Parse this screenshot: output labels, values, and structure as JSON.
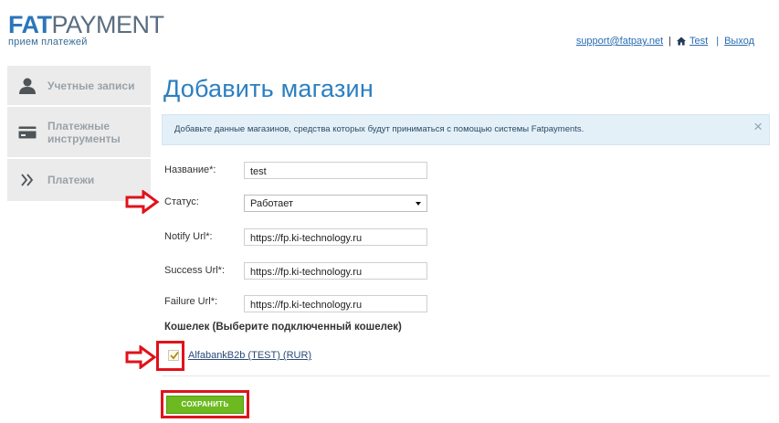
{
  "header": {
    "logo_fat": "FAT",
    "logo_payment": "PAYMENT",
    "logo_tagline": "прием платежей",
    "support_email": "support@fatpay.net",
    "separator": "|",
    "user_name": "Test",
    "logout_label": "Выход"
  },
  "sidebar": {
    "items": [
      {
        "label": "Учетные записи",
        "icon": "user-icon"
      },
      {
        "label": "Платежные инструменты",
        "icon": "card-icon"
      },
      {
        "label": "Платежи",
        "icon": "double-chevron-right-icon"
      }
    ]
  },
  "main": {
    "title": "Добавить магазин",
    "info_text": "Добавьте данные магазинов, средства которых будут приниматься с помощью системы Fatpayments.",
    "info_close": "×",
    "form": {
      "name": {
        "label": "Название*:",
        "value": "test"
      },
      "status": {
        "label": "Статус:",
        "value": "Работает"
      },
      "notify": {
        "label": "Notify Url*:",
        "value": "https://fp.ki-technology.ru"
      },
      "success": {
        "label": "Success Url*:",
        "value": "https://fp.ki-technology.ru"
      },
      "failure": {
        "label": "Failure Url*:",
        "value": "https://fp.ki-technology.ru"
      }
    },
    "wallet_title": "Кошелек (Выберите подключенный кошелек)",
    "wallet_option": {
      "label": "AlfabankB2b (TEST) (RUR)",
      "checked": true
    },
    "save_label": "СОХРАНИТЬ"
  },
  "colors": {
    "brand_blue": "#2b76b9",
    "title_blue": "#2b7fc0",
    "info_bg": "#e4f0f8",
    "save_green": "#6cba1f",
    "annotation_red": "#e0121b"
  }
}
